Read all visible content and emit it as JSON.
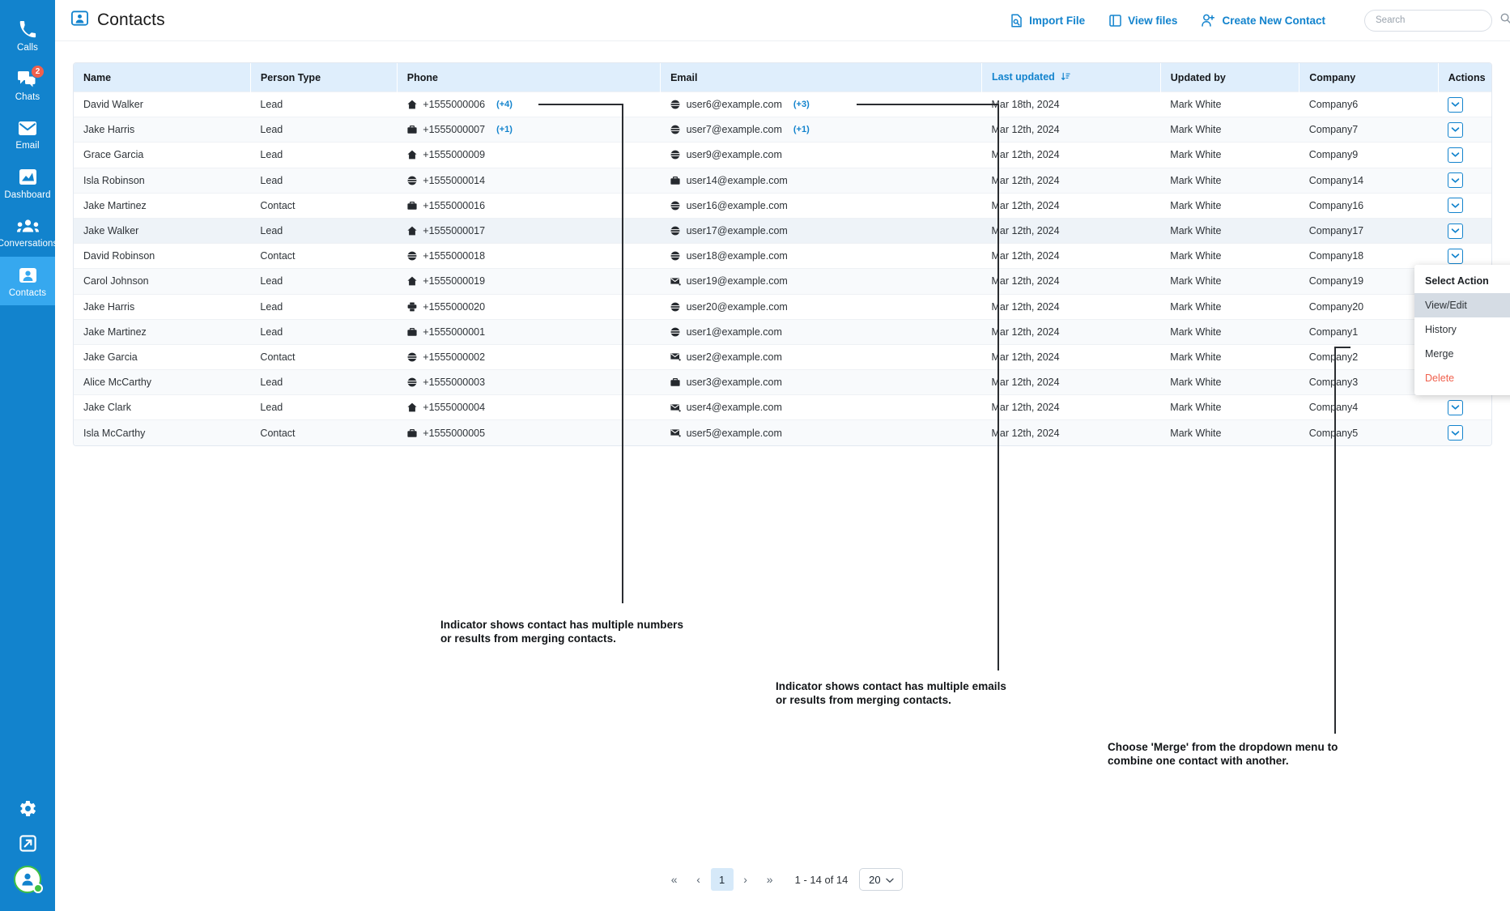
{
  "sidebar": {
    "items": [
      {
        "label": "Calls",
        "icon": "phone-icon",
        "badge": null,
        "active": false
      },
      {
        "label": "Chats",
        "icon": "chat-icon",
        "badge": "2",
        "active": false
      },
      {
        "label": "Email",
        "icon": "envelope-icon",
        "badge": null,
        "active": false
      },
      {
        "label": "Dashboard",
        "icon": "dashboard-icon",
        "badge": null,
        "active": false
      },
      {
        "label": "Conversations",
        "icon": "people-icon",
        "badge": null,
        "active": false
      },
      {
        "label": "Contacts",
        "icon": "contact-card-icon",
        "badge": null,
        "active": true
      }
    ],
    "bottom": [
      {
        "name": "settings-icon"
      },
      {
        "name": "logout-icon"
      },
      {
        "name": "user-avatar"
      }
    ],
    "accent": "#1283cd",
    "active_bg": "#36a8ef",
    "badge_color": "#f0604d",
    "status_color": "#3fc244"
  },
  "header": {
    "title": "Contacts",
    "icon": "contact-card-icon",
    "actions": [
      {
        "label": "Import File",
        "icon": "import-file-icon"
      },
      {
        "label": "View files",
        "icon": "view-files-icon"
      },
      {
        "label": "Create New Contact",
        "icon": "add-user-icon"
      }
    ],
    "search": {
      "placeholder": "Search",
      "value": "",
      "icon": "search-icon"
    },
    "link_color": "#1283cd"
  },
  "table": {
    "columns": [
      {
        "key": "name",
        "label": "Name",
        "sorted": false
      },
      {
        "key": "type",
        "label": "Person Type",
        "sorted": false
      },
      {
        "key": "phone",
        "label": "Phone",
        "sorted": false
      },
      {
        "key": "email",
        "label": "Email",
        "sorted": false
      },
      {
        "key": "updated",
        "label": "Last updated",
        "sorted": true,
        "sort_icon": "sort-desc-icon"
      },
      {
        "key": "updated_by",
        "label": "Updated by",
        "sorted": false
      },
      {
        "key": "company",
        "label": "Company",
        "sorted": false
      },
      {
        "key": "actions",
        "label": "Actions",
        "sorted": false
      }
    ],
    "header_bg": "#dfeefc",
    "rows": [
      {
        "name": "David Walker",
        "type": "Lead",
        "phone_icon": "home-icon",
        "phone": "+1555000006",
        "phone_extra": "(+4)",
        "email_icon": "globe-icon",
        "email": "user6@example.com",
        "email_extra": "(+3)",
        "updated": "Mar 18th, 2024",
        "updated_by": "Mark White",
        "company": "Company6",
        "highlight": false
      },
      {
        "name": "Jake Harris",
        "type": "Lead",
        "phone_icon": "briefcase-icon",
        "phone": "+1555000007",
        "phone_extra": "(+1)",
        "email_icon": "globe-icon",
        "email": "user7@example.com",
        "email_extra": "(+1)",
        "updated": "Mar 12th, 2024",
        "updated_by": "Mark White",
        "company": "Company7",
        "highlight": false
      },
      {
        "name": "Grace Garcia",
        "type": "Lead",
        "phone_icon": "home-icon",
        "phone": "+1555000009",
        "phone_extra": "",
        "email_icon": "globe-icon",
        "email": "user9@example.com",
        "email_extra": "",
        "updated": "Mar 12th, 2024",
        "updated_by": "Mark White",
        "company": "Company9",
        "highlight": false
      },
      {
        "name": "Isla Robinson",
        "type": "Lead",
        "phone_icon": "globe-icon",
        "phone": "+1555000014",
        "phone_extra": "",
        "email_icon": "briefcase-icon",
        "email": "user14@example.com",
        "email_extra": "",
        "updated": "Mar 12th, 2024",
        "updated_by": "Mark White",
        "company": "Company14",
        "highlight": false
      },
      {
        "name": "Jake Martinez",
        "type": "Contact",
        "phone_icon": "briefcase-icon",
        "phone": "+1555000016",
        "phone_extra": "",
        "email_icon": "globe-icon",
        "email": "user16@example.com",
        "email_extra": "",
        "updated": "Mar 12th, 2024",
        "updated_by": "Mark White",
        "company": "Company16",
        "highlight": false
      },
      {
        "name": "Jake Walker",
        "type": "Lead",
        "phone_icon": "home-icon",
        "phone": "+1555000017",
        "phone_extra": "",
        "email_icon": "globe-icon",
        "email": "user17@example.com",
        "email_extra": "",
        "updated": "Mar 12th, 2024",
        "updated_by": "Mark White",
        "company": "Company17",
        "highlight": true
      },
      {
        "name": "David Robinson",
        "type": "Contact",
        "phone_icon": "globe-icon",
        "phone": "+1555000018",
        "phone_extra": "",
        "email_icon": "globe-icon",
        "email": "user18@example.com",
        "email_extra": "",
        "updated": "Mar 12th, 2024",
        "updated_by": "Mark White",
        "company": "Company18",
        "highlight": false
      },
      {
        "name": "Carol Johnson",
        "type": "Lead",
        "phone_icon": "home-icon",
        "phone": "+1555000019",
        "phone_extra": "",
        "email_icon": "envelope-icon",
        "email": "user19@example.com",
        "email_extra": "",
        "updated": "Mar 12th, 2024",
        "updated_by": "Mark White",
        "company": "Company19",
        "highlight": false
      },
      {
        "name": "Jake Harris",
        "type": "Lead",
        "phone_icon": "fax-icon",
        "phone": "+1555000020",
        "phone_extra": "",
        "email_icon": "globe-icon",
        "email": "user20@example.com",
        "email_extra": "",
        "updated": "Mar 12th, 2024",
        "updated_by": "Mark White",
        "company": "Company20",
        "highlight": false
      },
      {
        "name": "Jake Martinez",
        "type": "Lead",
        "phone_icon": "briefcase-icon",
        "phone": "+1555000001",
        "phone_extra": "",
        "email_icon": "globe-icon",
        "email": "user1@example.com",
        "email_extra": "",
        "updated": "Mar 12th, 2024",
        "updated_by": "Mark White",
        "company": "Company1",
        "highlight": false
      },
      {
        "name": "Jake Garcia",
        "type": "Contact",
        "phone_icon": "globe-icon",
        "phone": "+1555000002",
        "phone_extra": "",
        "email_icon": "envelope-icon",
        "email": "user2@example.com",
        "email_extra": "",
        "updated": "Mar 12th, 2024",
        "updated_by": "Mark White",
        "company": "Company2",
        "highlight": false
      },
      {
        "name": "Alice McCarthy",
        "type": "Lead",
        "phone_icon": "globe-icon",
        "phone": "+1555000003",
        "phone_extra": "",
        "email_icon": "briefcase-icon",
        "email": "user3@example.com",
        "email_extra": "",
        "updated": "Mar 12th, 2024",
        "updated_by": "Mark White",
        "company": "Company3",
        "highlight": false
      },
      {
        "name": "Jake Clark",
        "type": "Lead",
        "phone_icon": "home-icon",
        "phone": "+1555000004",
        "phone_extra": "",
        "email_icon": "envelope-icon",
        "email": "user4@example.com",
        "email_extra": "",
        "updated": "Mar 12th, 2024",
        "updated_by": "Mark White",
        "company": "Company4",
        "highlight": false
      },
      {
        "name": "Isla McCarthy",
        "type": "Contact",
        "phone_icon": "briefcase-icon",
        "phone": "+1555000005",
        "phone_extra": "",
        "email_icon": "envelope-icon",
        "email": "user5@example.com",
        "email_extra": "",
        "updated": "Mar 12th, 2024",
        "updated_by": "Mark White",
        "company": "Company5",
        "highlight": false
      }
    ],
    "row_action_icon": "chevron-down-icon"
  },
  "dropdown": {
    "title": "Select Action",
    "items": [
      {
        "label": "View/Edit",
        "selected": true,
        "danger": false
      },
      {
        "label": "History",
        "selected": false,
        "danger": false
      },
      {
        "label": "Merge",
        "selected": false,
        "danger": false
      },
      {
        "label": "Delete",
        "selected": false,
        "danger": true
      }
    ],
    "danger_color": "#f0604d"
  },
  "callouts": [
    {
      "line1": "Indicator shows contact has multiple numbers",
      "line2": "or results from merging contacts."
    },
    {
      "line1": "Indicator shows contact has multiple emails",
      "line2": "or results from merging contacts."
    },
    {
      "line1": "Choose 'Merge' from the dropdown menu to",
      "line2": "combine one contact with another."
    }
  ],
  "pagination": {
    "first": "«",
    "prev": "‹",
    "current_page": "1",
    "next": "›",
    "last": "»",
    "range_text": "1 - 14 of 14",
    "page_size": "20",
    "page_size_icon": "chevron-down-icon"
  }
}
